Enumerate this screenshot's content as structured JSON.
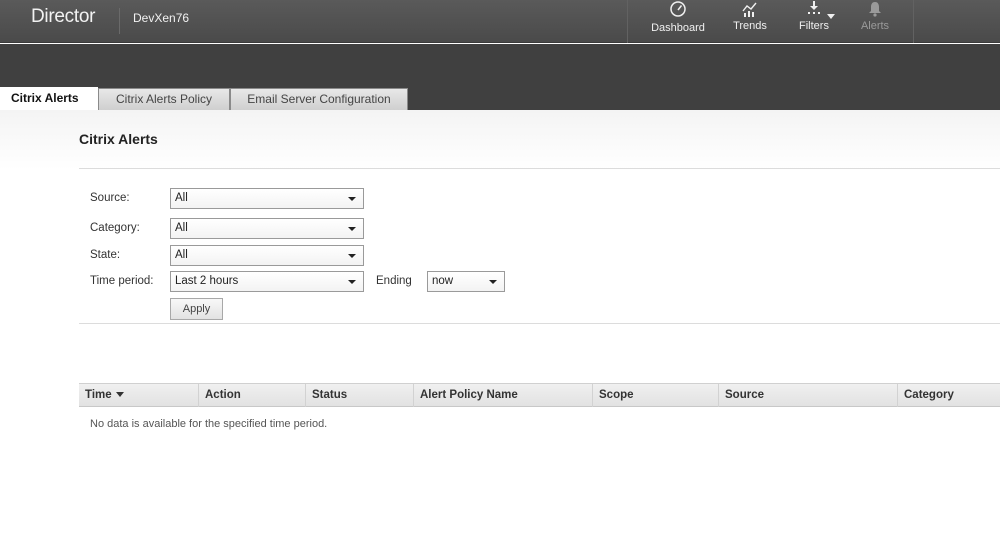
{
  "header": {
    "brand": "Director",
    "site_name": "DevXen76",
    "nav": {
      "dashboard": "Dashboard",
      "trends": "Trends",
      "filters": "Filters",
      "alerts": "Alerts"
    }
  },
  "tabs": [
    {
      "label": "Citrix Alerts",
      "active": true
    },
    {
      "label": "Citrix Alerts Policy",
      "active": false
    },
    {
      "label": "Email Server Configuration",
      "active": false
    }
  ],
  "page": {
    "title": "Citrix Alerts"
  },
  "filters": {
    "source_label": "Source:",
    "source_value": "All",
    "category_label": "Category:",
    "category_value": "All",
    "state_label": "State:",
    "state_value": "All",
    "time_period_label": "Time period:",
    "time_period_value": "Last 2 hours",
    "ending_label": "Ending",
    "ending_value": "now",
    "apply_label": "Apply"
  },
  "table": {
    "columns": [
      "Time",
      "Action",
      "Status",
      "Alert Policy Name",
      "Scope",
      "Source",
      "Category"
    ],
    "sorted_column": "Time",
    "empty_message": "No data is available for the specified time period."
  },
  "icons": {
    "dashboard": "gauge-icon",
    "trends": "chart-icon",
    "filters": "filter-icon",
    "alerts": "bell-icon"
  },
  "colors": {
    "topbar": "#4f4f4f",
    "band": "#404040",
    "disabled_nav": "#9a9a9a"
  }
}
